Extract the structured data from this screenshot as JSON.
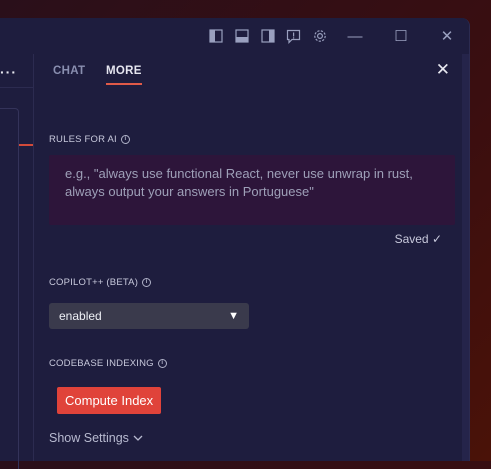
{
  "titlebar": {
    "icons": [
      "sidebar-left-icon",
      "panel-bottom-icon",
      "sidebar-right-icon",
      "feedback-icon",
      "gear-icon"
    ],
    "minimize": "—",
    "maximize": "☐",
    "close": "✕"
  },
  "leftpane": {
    "more": "···"
  },
  "tabs": [
    {
      "label": "CHAT",
      "active": false
    },
    {
      "label": "MORE",
      "active": true
    }
  ],
  "panel_close": "✕",
  "rules": {
    "label": "RULES FOR AI",
    "placeholder": "e.g., \"always use functional React, never use unwrap in rust, always output your answers in Portuguese\"",
    "status": "Saved ✓"
  },
  "copilot": {
    "label": "COPILOT++ (BETA)",
    "selected": "enabled"
  },
  "indexing": {
    "label": "CODEBASE INDEXING",
    "button": "Compute Index",
    "show_settings": "Show Settings"
  },
  "colors": {
    "accent": "#e0433a",
    "panel_bg": "#1e1d3e",
    "rules_bg": "#2d153a"
  }
}
